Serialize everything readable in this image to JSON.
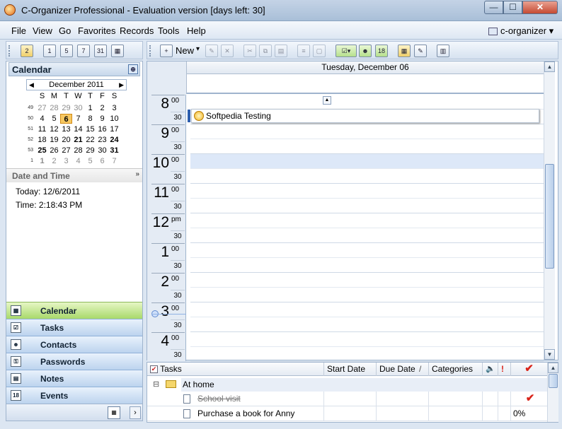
{
  "window": {
    "title": "C-Organizer Professional - Evaluation version [days left: 30]",
    "minimize": "—",
    "maximize": "☐",
    "close": "✕"
  },
  "menu": {
    "file": "File",
    "view": "View",
    "go": "Go",
    "favorites": "Favorites",
    "records": "Records",
    "tools": "Tools",
    "help": "Help",
    "profile": "c-organizer",
    "profile_arrow": "▾"
  },
  "toolbar": {
    "new_label": "New",
    "new_arrow": "▾"
  },
  "calendar_panel": {
    "title": "Calendar",
    "pin": "⊕",
    "month_label": "December 2011",
    "prev": "◀",
    "next": "▶",
    "weekdays": [
      "S",
      "M",
      "T",
      "W",
      "T",
      "F",
      "S"
    ],
    "weeks": [
      {
        "wk": "49",
        "days": [
          "27",
          "28",
          "29",
          "30",
          "1",
          "2",
          "3"
        ]
      },
      {
        "wk": "50",
        "days": [
          "4",
          "5",
          "6",
          "7",
          "8",
          "9",
          "10"
        ]
      },
      {
        "wk": "51",
        "days": [
          "11",
          "12",
          "13",
          "14",
          "15",
          "16",
          "17"
        ]
      },
      {
        "wk": "52",
        "days": [
          "18",
          "19",
          "20",
          "21",
          "22",
          "23",
          "24"
        ]
      },
      {
        "wk": "53",
        "days": [
          "25",
          "26",
          "27",
          "28",
          "29",
          "30",
          "31"
        ]
      },
      {
        "wk": "1",
        "days": [
          "1",
          "2",
          "3",
          "4",
          "5",
          "6",
          "7"
        ]
      }
    ],
    "date_time_title": "Date and Time",
    "collapse": "»",
    "today": "Today: 12/6/2011",
    "time": "Time: 2:18:43 PM"
  },
  "nav": {
    "calendar": "Calendar",
    "tasks": "Tasks",
    "contacts": "Contacts",
    "passwords": "Passwords",
    "notes": "Notes",
    "events": "Events",
    "more": "›"
  },
  "dayview": {
    "date_header": "Tuesday, December 06",
    "hours": [
      {
        "h": "8",
        "m": "00"
      },
      {
        "h": "9",
        "m": "00"
      },
      {
        "h": "10",
        "m": "00"
      },
      {
        "h": "11",
        "m": "00"
      },
      {
        "h": "12",
        "m": "pm"
      },
      {
        "h": "1",
        "m": "00"
      },
      {
        "h": "2",
        "m": "00"
      },
      {
        "h": "3",
        "m": "00"
      },
      {
        "h": "4",
        "m": "00"
      }
    ],
    "half": "30",
    "appointment": "Softpedia Testing",
    "scroll_up": "▲",
    "scroll_down": "▼"
  },
  "tasks": {
    "headers": {
      "tasks": "Tasks",
      "start_date": "Start Date",
      "due_date": "Due Date",
      "sort": "/",
      "categories": "Categories",
      "reminder": "🔈",
      "priority": "!",
      "complete": "✔"
    },
    "group_toggle": "⊟",
    "group": "At home",
    "rows": [
      {
        "title": "School visit",
        "start": "",
        "due": "",
        "categories": "",
        "complete": "✔"
      },
      {
        "title": "Purchase a book for Anny",
        "start": "",
        "due": "",
        "categories": "",
        "complete": "0%"
      }
    ]
  }
}
